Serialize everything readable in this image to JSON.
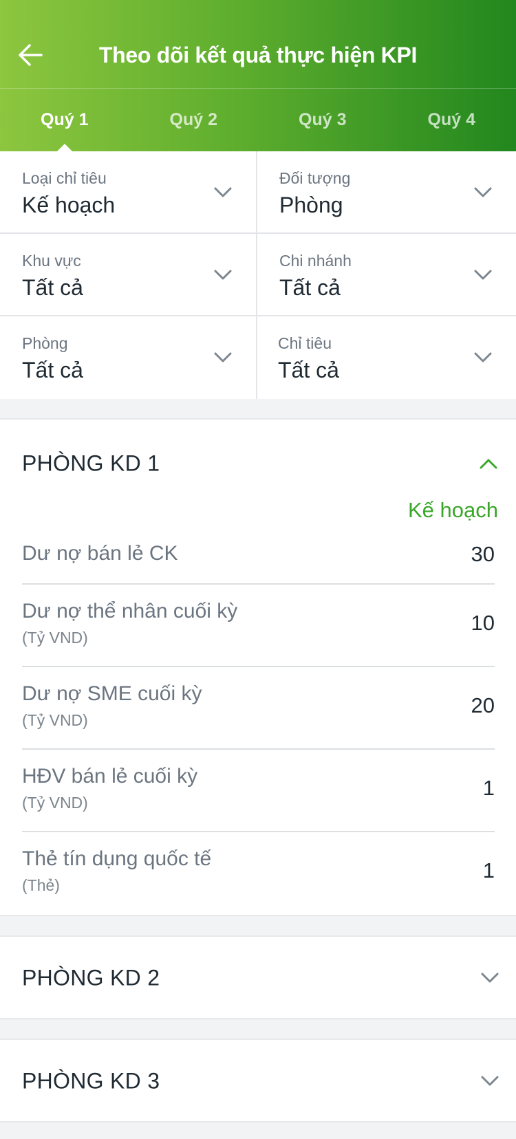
{
  "header": {
    "title": "Theo dõi kết quả thực hiện KPI",
    "back_icon": "arrow-left-icon",
    "gradient": [
      "#8dc63f",
      "#22871e"
    ]
  },
  "tabs": [
    {
      "label": "Quý 1",
      "active": true
    },
    {
      "label": "Quý 2",
      "active": false
    },
    {
      "label": "Quý 3",
      "active": false
    },
    {
      "label": "Quý 4",
      "active": false
    }
  ],
  "filters": [
    {
      "label": "Loại chỉ tiêu",
      "value": "Kế hoạch"
    },
    {
      "label": "Đối tượng",
      "value": "Phòng"
    },
    {
      "label": "Khu vực",
      "value": "Tất cả"
    },
    {
      "label": "Chi nhánh",
      "value": "Tất cả"
    },
    {
      "label": "Phòng",
      "value": "Tất cả"
    },
    {
      "label": "Chỉ tiêu",
      "value": "Tất cả"
    }
  ],
  "sections": [
    {
      "title": "PHÒNG KD 1",
      "expanded": true,
      "column_header": "Kế hoạch",
      "rows": [
        {
          "name": "Dư nợ bán lẻ CK",
          "unit": "",
          "value": "30"
        },
        {
          "name": "Dư nợ thể nhân cuối kỳ",
          "unit": "(Tỷ VND)",
          "value": "10"
        },
        {
          "name": "Dư nợ SME cuối kỳ",
          "unit": "(Tỷ VND)",
          "value": "20"
        },
        {
          "name": "HĐV bán lẻ cuối kỳ",
          "unit": "(Tỷ VND)",
          "value": "1"
        },
        {
          "name": "Thẻ tín dụng quốc tế",
          "unit": "(Thẻ)",
          "value": "1"
        }
      ]
    },
    {
      "title": "PHÒNG KD 2",
      "expanded": false
    },
    {
      "title": "PHÒNG KD 3",
      "expanded": false
    }
  ],
  "colors": {
    "accent_green": "#3aa72a",
    "chevron_gray": "#7d8790"
  }
}
